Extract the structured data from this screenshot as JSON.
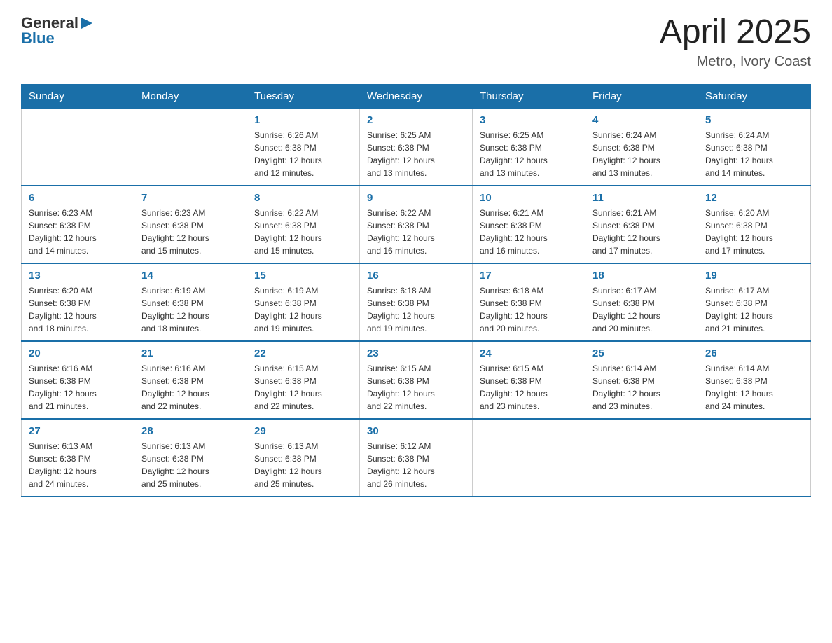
{
  "header": {
    "logo_general": "General",
    "logo_blue": "Blue",
    "month_year": "April 2025",
    "location": "Metro, Ivory Coast"
  },
  "days_of_week": [
    "Sunday",
    "Monday",
    "Tuesday",
    "Wednesday",
    "Thursday",
    "Friday",
    "Saturday"
  ],
  "weeks": [
    [
      {
        "day": "",
        "info": ""
      },
      {
        "day": "",
        "info": ""
      },
      {
        "day": "1",
        "info": "Sunrise: 6:26 AM\nSunset: 6:38 PM\nDaylight: 12 hours\nand 12 minutes."
      },
      {
        "day": "2",
        "info": "Sunrise: 6:25 AM\nSunset: 6:38 PM\nDaylight: 12 hours\nand 13 minutes."
      },
      {
        "day": "3",
        "info": "Sunrise: 6:25 AM\nSunset: 6:38 PM\nDaylight: 12 hours\nand 13 minutes."
      },
      {
        "day": "4",
        "info": "Sunrise: 6:24 AM\nSunset: 6:38 PM\nDaylight: 12 hours\nand 13 minutes."
      },
      {
        "day": "5",
        "info": "Sunrise: 6:24 AM\nSunset: 6:38 PM\nDaylight: 12 hours\nand 14 minutes."
      }
    ],
    [
      {
        "day": "6",
        "info": "Sunrise: 6:23 AM\nSunset: 6:38 PM\nDaylight: 12 hours\nand 14 minutes."
      },
      {
        "day": "7",
        "info": "Sunrise: 6:23 AM\nSunset: 6:38 PM\nDaylight: 12 hours\nand 15 minutes."
      },
      {
        "day": "8",
        "info": "Sunrise: 6:22 AM\nSunset: 6:38 PM\nDaylight: 12 hours\nand 15 minutes."
      },
      {
        "day": "9",
        "info": "Sunrise: 6:22 AM\nSunset: 6:38 PM\nDaylight: 12 hours\nand 16 minutes."
      },
      {
        "day": "10",
        "info": "Sunrise: 6:21 AM\nSunset: 6:38 PM\nDaylight: 12 hours\nand 16 minutes."
      },
      {
        "day": "11",
        "info": "Sunrise: 6:21 AM\nSunset: 6:38 PM\nDaylight: 12 hours\nand 17 minutes."
      },
      {
        "day": "12",
        "info": "Sunrise: 6:20 AM\nSunset: 6:38 PM\nDaylight: 12 hours\nand 17 minutes."
      }
    ],
    [
      {
        "day": "13",
        "info": "Sunrise: 6:20 AM\nSunset: 6:38 PM\nDaylight: 12 hours\nand 18 minutes."
      },
      {
        "day": "14",
        "info": "Sunrise: 6:19 AM\nSunset: 6:38 PM\nDaylight: 12 hours\nand 18 minutes."
      },
      {
        "day": "15",
        "info": "Sunrise: 6:19 AM\nSunset: 6:38 PM\nDaylight: 12 hours\nand 19 minutes."
      },
      {
        "day": "16",
        "info": "Sunrise: 6:18 AM\nSunset: 6:38 PM\nDaylight: 12 hours\nand 19 minutes."
      },
      {
        "day": "17",
        "info": "Sunrise: 6:18 AM\nSunset: 6:38 PM\nDaylight: 12 hours\nand 20 minutes."
      },
      {
        "day": "18",
        "info": "Sunrise: 6:17 AM\nSunset: 6:38 PM\nDaylight: 12 hours\nand 20 minutes."
      },
      {
        "day": "19",
        "info": "Sunrise: 6:17 AM\nSunset: 6:38 PM\nDaylight: 12 hours\nand 21 minutes."
      }
    ],
    [
      {
        "day": "20",
        "info": "Sunrise: 6:16 AM\nSunset: 6:38 PM\nDaylight: 12 hours\nand 21 minutes."
      },
      {
        "day": "21",
        "info": "Sunrise: 6:16 AM\nSunset: 6:38 PM\nDaylight: 12 hours\nand 22 minutes."
      },
      {
        "day": "22",
        "info": "Sunrise: 6:15 AM\nSunset: 6:38 PM\nDaylight: 12 hours\nand 22 minutes."
      },
      {
        "day": "23",
        "info": "Sunrise: 6:15 AM\nSunset: 6:38 PM\nDaylight: 12 hours\nand 22 minutes."
      },
      {
        "day": "24",
        "info": "Sunrise: 6:15 AM\nSunset: 6:38 PM\nDaylight: 12 hours\nand 23 minutes."
      },
      {
        "day": "25",
        "info": "Sunrise: 6:14 AM\nSunset: 6:38 PM\nDaylight: 12 hours\nand 23 minutes."
      },
      {
        "day": "26",
        "info": "Sunrise: 6:14 AM\nSunset: 6:38 PM\nDaylight: 12 hours\nand 24 minutes."
      }
    ],
    [
      {
        "day": "27",
        "info": "Sunrise: 6:13 AM\nSunset: 6:38 PM\nDaylight: 12 hours\nand 24 minutes."
      },
      {
        "day": "28",
        "info": "Sunrise: 6:13 AM\nSunset: 6:38 PM\nDaylight: 12 hours\nand 25 minutes."
      },
      {
        "day": "29",
        "info": "Sunrise: 6:13 AM\nSunset: 6:38 PM\nDaylight: 12 hours\nand 25 minutes."
      },
      {
        "day": "30",
        "info": "Sunrise: 6:12 AM\nSunset: 6:38 PM\nDaylight: 12 hours\nand 26 minutes."
      },
      {
        "day": "",
        "info": ""
      },
      {
        "day": "",
        "info": ""
      },
      {
        "day": "",
        "info": ""
      }
    ]
  ]
}
